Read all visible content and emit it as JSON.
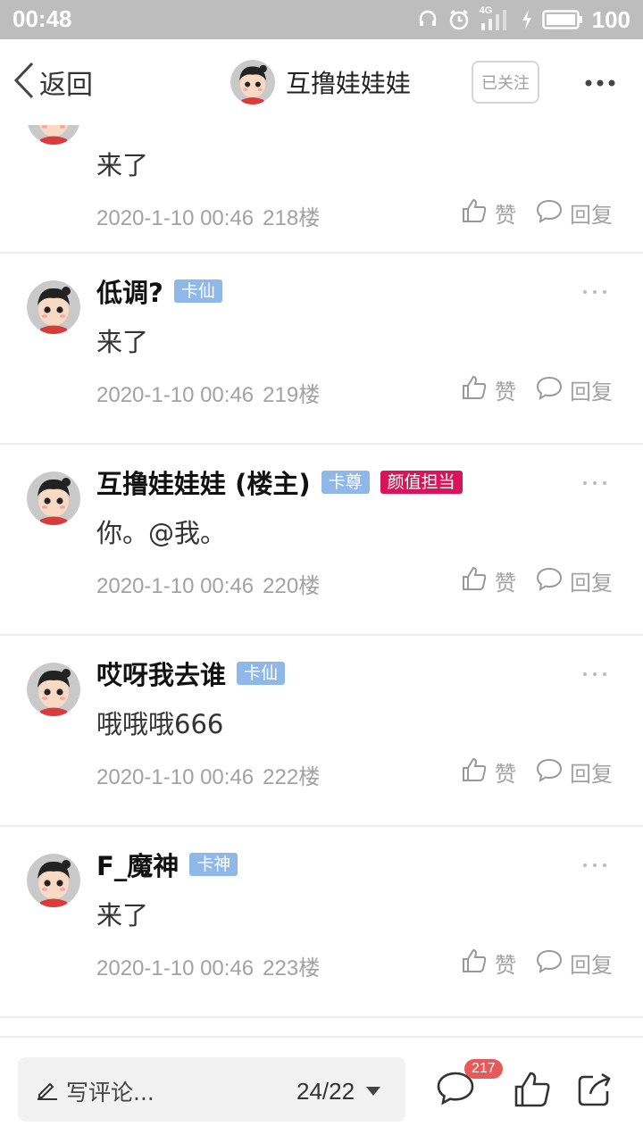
{
  "status_bar": {
    "time": "00:48",
    "battery": "100",
    "network": "4G"
  },
  "nav": {
    "back_label": "返回",
    "title": "互撸娃娃娃",
    "follow_label": "已关注"
  },
  "posts": [
    {
      "username": "",
      "badges": [],
      "text": "来了",
      "datetime": "2020-1-10 00:46",
      "floor": "218楼",
      "like_label": "赞",
      "reply_label": "回复"
    },
    {
      "username": "低调?",
      "badges": [
        {
          "label": "卡仙",
          "color": "#8fb8e8"
        }
      ],
      "text": "来了",
      "datetime": "2020-1-10 00:46",
      "floor": "219楼",
      "like_label": "赞",
      "reply_label": "回复"
    },
    {
      "username": "互撸娃娃娃 (楼主)",
      "badges": [
        {
          "label": "卡尊",
          "color": "#8fb8e8"
        },
        {
          "label": "颜值担当",
          "color": "#d8155a"
        }
      ],
      "text": "你。@我。",
      "datetime": "2020-1-10 00:46",
      "floor": "220楼",
      "like_label": "赞",
      "reply_label": "回复"
    },
    {
      "username": "哎呀我去谁",
      "badges": [
        {
          "label": "卡仙",
          "color": "#8fb8e8"
        }
      ],
      "text": "哦哦哦666",
      "datetime": "2020-1-10 00:46",
      "floor": "222楼",
      "like_label": "赞",
      "reply_label": "回复"
    },
    {
      "username": "F_魔神",
      "badges": [
        {
          "label": "卡神",
          "color": "#8fb8e8"
        }
      ],
      "text": "来了",
      "datetime": "2020-1-10 00:46",
      "floor": "223楼",
      "like_label": "赞",
      "reply_label": "回复"
    }
  ],
  "bottom_bar": {
    "comment_placeholder": "写评论...",
    "page_indicator": "24/22",
    "comment_count": "217"
  },
  "icons": {
    "back": "chevron-left-icon",
    "more": "more-horizontal-icon",
    "like": "thumbs-up-icon",
    "reply": "speech-bubble-icon",
    "pencil": "pencil-icon",
    "dropdown": "triangle-down-icon",
    "share": "share-icon",
    "alarm": "alarm-clock-icon",
    "headset": "headset-icon",
    "signal": "signal-icon",
    "charging": "bolt-icon",
    "battery": "battery-icon"
  },
  "colors": {
    "status_bar": "#bdbdbd",
    "badge_blue": "#8fb8e8",
    "badge_pink": "#d8155a",
    "count_badge": "#e85a5a",
    "meta_gray": "#a2a2a2"
  }
}
